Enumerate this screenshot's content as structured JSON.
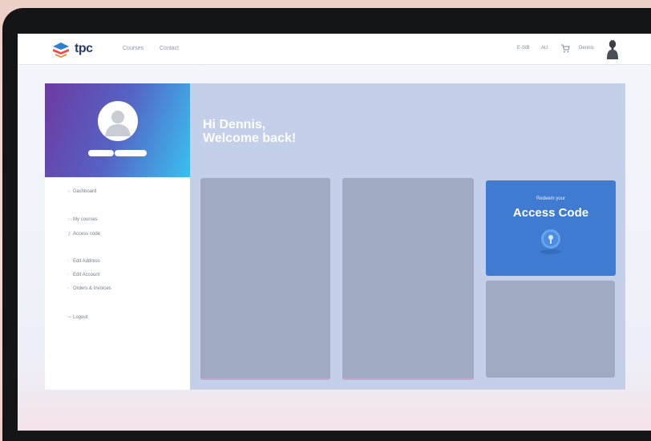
{
  "header": {
    "brand": "tpc",
    "nav": [
      "Courses",
      "Contact"
    ],
    "right": {
      "lang": "E-SIB",
      "region": "AU",
      "user": "Dennis"
    },
    "icons": [
      "cart-icon",
      "user-avatar-icon"
    ]
  },
  "sidebar": {
    "items": [
      {
        "label": "Dashboard",
        "icon": "home-icon"
      },
      {
        "label": "My courses",
        "icon": "book-icon"
      },
      {
        "label": "Access code",
        "icon": "key-icon"
      },
      {
        "label": "Edit Address",
        "icon": "pin-icon"
      },
      {
        "label": "Edit Account",
        "icon": "user-icon"
      },
      {
        "label": "Orders & Invoices",
        "icon": "receipt-icon"
      },
      {
        "label": "Logout",
        "icon": "logout-icon"
      }
    ]
  },
  "main": {
    "greeting_line1": "Hi Dennis,",
    "greeting_line2": "Welcome back!",
    "access_card": {
      "kicker": "Redeem your",
      "title": "Access Code"
    }
  },
  "colors": {
    "accent_blue": "#3f7bd0",
    "dashboard_bg": "#c4cfea",
    "placeholder_card": "#a1aac3",
    "sidebar_gradient_start": "#6d3aa2",
    "sidebar_gradient_end": "#39c1ef"
  }
}
